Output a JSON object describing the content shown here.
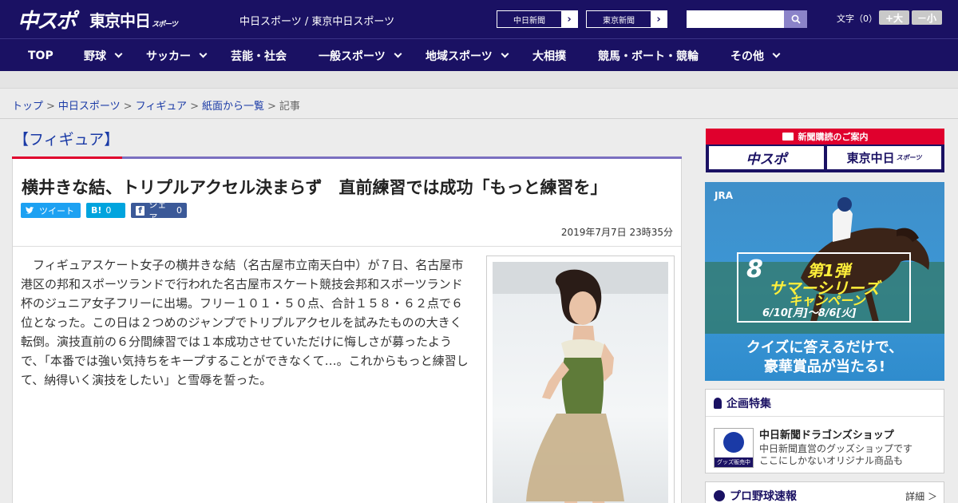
{
  "header": {
    "logo_chuspo": "中スポ",
    "logo_tokyo": "東京中日",
    "logo_tokyo_sub": "スポーツ",
    "site_name": "中日スポーツ / 東京中日スポーツ",
    "link_chunichi": "中日新聞",
    "link_tokyo": "東京新聞",
    "search_placeholder": "",
    "font_size_label": "文字（0）",
    "font_bigger": "+大",
    "font_smaller": "－小"
  },
  "nav": [
    {
      "label": "TOP",
      "dropdown": false
    },
    {
      "label": "野球",
      "dropdown": true
    },
    {
      "label": "サッカー",
      "dropdown": true
    },
    {
      "label": "芸能・社会",
      "dropdown": false
    },
    {
      "label": "一般スポーツ",
      "dropdown": true
    },
    {
      "label": "地域スポーツ",
      "dropdown": true
    },
    {
      "label": "大相撲",
      "dropdown": false
    },
    {
      "label": "競馬・ボート・競輪",
      "dropdown": false
    },
    {
      "label": "その他",
      "dropdown": true
    }
  ],
  "breadcrumb": {
    "items": [
      "トップ",
      "中日スポーツ",
      "フィギュア",
      "紙面から一覧"
    ],
    "current": "記事",
    "separator": ">"
  },
  "category": "【フィギュア】",
  "article": {
    "headline": "横井きな結、トリプルアクセル決まらず　直前練習では成功「もっと練習を」",
    "share": {
      "tweet": "ツイート",
      "hatena_icon": "B!",
      "hatena_count": "0",
      "facebook_label": "シェア",
      "facebook_count": "0"
    },
    "date": "2019年7月7日 23時35分",
    "body_lines": [
      "フィギュアスケート女子の横井きな結（名古屋市立南天白中）が７日、名古",
      "屋市港区の邦和スポーツランドで行われた名古屋市スケート競技会邦和スポー",
      "ツランド杯のジュニア女子フリーに出場。フリー１０１・５０点、合計１５",
      "８・６２点で６位となった。この日は２つめのジャンプでトリプルアクセルを",
      "試みたものの大きく転倒。演技直前の６分間練習では１本成功させていただけ",
      "に悔しさが募ったようで、「本番では強い気持ちをキープすることができなく",
      "て…。これからもっと練習して、納得いく演技をしたい」と雪辱を誓った。"
    ]
  },
  "sidebar": {
    "subscribe_head": "新聞購読のご案内",
    "subscribe_chuspo": "中スポ",
    "subscribe_tokyo": "東京中日",
    "subscribe_tokyo_sub": "スポーツ",
    "ad": {
      "brand": "JRA",
      "number": "8",
      "title1": "第1弾",
      "title2": "サマーシリーズ",
      "title3": "キャンペーン",
      "period": "6/10[月]～8/6[火]",
      "quiz1": "クイズに答えるだけで、",
      "quiz2": "豪華賞品が当たる!"
    },
    "feature": {
      "title": "企画特集",
      "shop_title": "中日新聞ドラゴンズショップ",
      "shop_desc1": "中日新聞直営のグッズショップです",
      "shop_desc2": "ここにしかないオリジナル商品も",
      "shop_badge": "グッズ販売中"
    },
    "baseball": {
      "title": "プロ野球速報",
      "detail": "詳細 ＞"
    }
  },
  "colors": {
    "brand_navy": "#1a1163",
    "accent_red": "#e0002d",
    "twitter": "#1da1f2",
    "hatena": "#00a4de",
    "facebook": "#3b5998",
    "link_blue": "#1a3aa6"
  }
}
